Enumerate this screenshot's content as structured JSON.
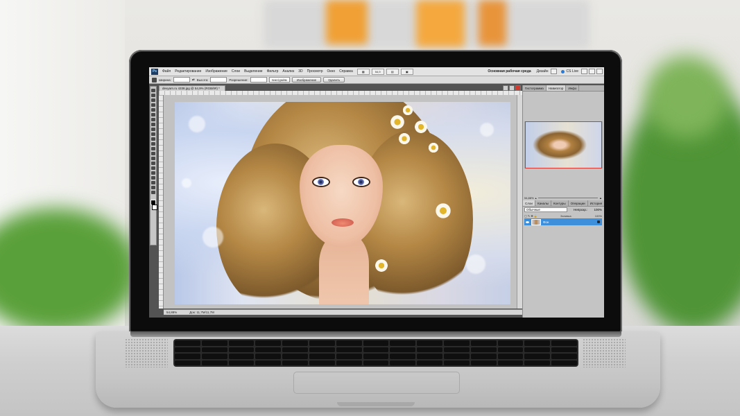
{
  "menubar": {
    "app_icon": "Ps",
    "items": [
      "Файл",
      "Редактирование",
      "Изображение",
      "Слои",
      "Выделение",
      "Фильтр",
      "Анализ",
      "3D",
      "Просмотр",
      "Окно",
      "Справка"
    ],
    "zoom": "54,9",
    "workspace": "Основная рабочая среда",
    "design": "Дизайн",
    "cs_live": "CS Live"
  },
  "options": {
    "width_label": "Ширина:",
    "height_label": "Высота:",
    "resolution_label": "Разрешение:",
    "resolution_unit": "пикс/дюйм",
    "image_button": "Изображение",
    "clear_button": "Удалить"
  },
  "document": {
    "tab_title": "devyarn.ru 4338.jpg @ 54,9% (RGB/8#) *",
    "status_zoom": "54,88%",
    "status_doc": "Док: 11,7M/11,7M"
  },
  "navigator_panel": {
    "tabs": [
      "Гистограмма",
      "Навигатор",
      "Инфо"
    ],
    "active": "Навигатор",
    "zoom": "54,88%"
  },
  "layers_panel": {
    "tabs": [
      "Слои",
      "Каналы",
      "Контуры",
      "Операции",
      "История"
    ],
    "active": "Слои",
    "blend_mode": "Обычные",
    "opacity_label": "Непрозр.:",
    "opacity": "100%",
    "fill_label": "Заливка:",
    "fill": "100%",
    "layer_name": "Фон"
  },
  "colors": {
    "accent": "#3d8fdc",
    "close": "#d2392f"
  }
}
